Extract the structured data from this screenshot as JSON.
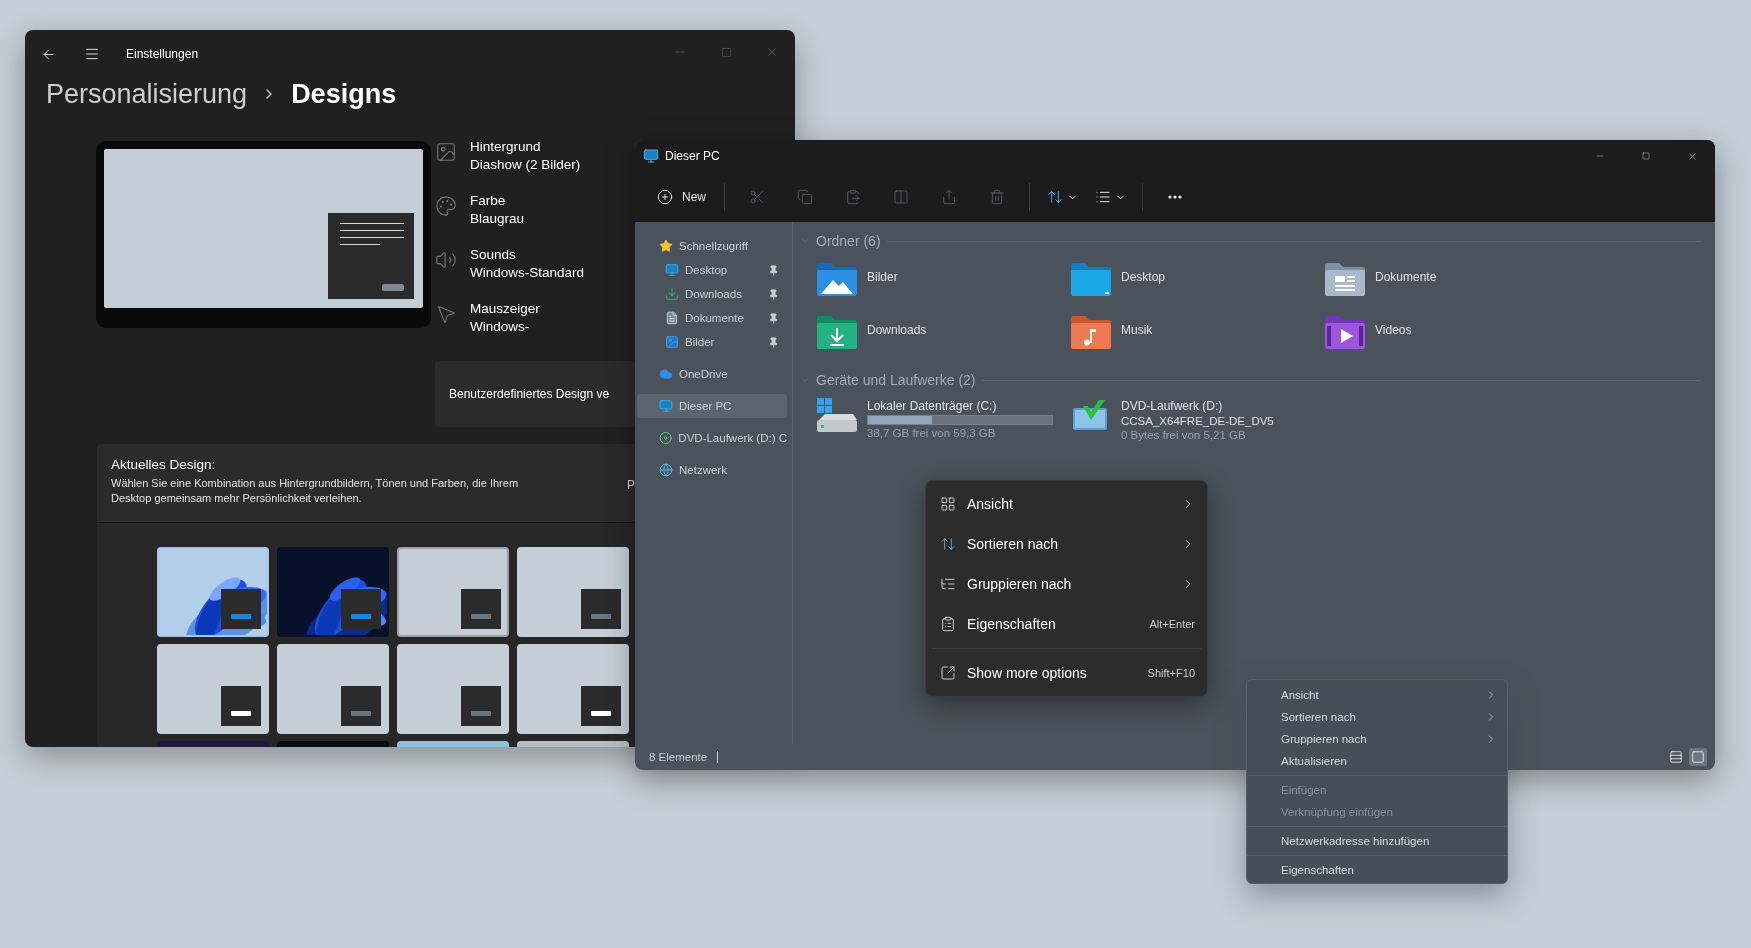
{
  "settings": {
    "title": "Einstellungen",
    "breadcrumb": [
      {
        "label": "Personalisierung",
        "selected": false
      },
      {
        "label": "Designs",
        "selected": true
      }
    ],
    "summary": [
      {
        "kind": "background",
        "label": "Hintergrund",
        "value": "Diashow (2 Bilder)"
      },
      {
        "kind": "color",
        "label": "Farbe",
        "value": "Blaugrau"
      },
      {
        "kind": "sounds",
        "label": "Sounds",
        "value": "Windows-Standard"
      },
      {
        "kind": "pointer",
        "label": "Mauszeiger",
        "value": "Windows-"
      }
    ],
    "custom_design": "Benutzerdefiniertes Design ve",
    "current_design": {
      "title": "Aktuelles Design:",
      "description": "Wählen Sie eine Kombination aus Hintergrundbildern, Tönen und Farben, die Ihrem Desktop gemeinsam mehr Persönlichkeit verleihen.",
      "action": "P"
    },
    "themes": [
      {
        "kind": "bloom-light",
        "selected": false,
        "color": "#1a86d9"
      },
      {
        "kind": "bloom-dark",
        "selected": false,
        "color": "#1a86d9"
      },
      {
        "kind": "plain",
        "selected": true,
        "color": "#6b7580"
      },
      {
        "kind": "plain",
        "selected": false,
        "color": "#6b7580"
      },
      {
        "kind": "plain",
        "selected": false,
        "color": "#ffffff"
      },
      {
        "kind": "plain",
        "selected": false,
        "color": "#6b7580"
      },
      {
        "kind": "plain",
        "selected": false,
        "color": "#6b7580"
      },
      {
        "kind": "plain",
        "selected": false,
        "color": "#ffffff"
      },
      {
        "kind": "night",
        "selected": false
      },
      {
        "kind": "black",
        "selected": false
      },
      {
        "kind": "sky",
        "selected": false
      },
      {
        "kind": "fog",
        "selected": false
      }
    ]
  },
  "explorer": {
    "title": "Dieser PC",
    "toolbar": [
      {
        "kind": "new",
        "label": "New",
        "disabled": false
      },
      {
        "kind": "cut",
        "disabled": true
      },
      {
        "kind": "copy",
        "disabled": true
      },
      {
        "kind": "paste",
        "disabled": true
      },
      {
        "kind": "rename",
        "disabled": true
      },
      {
        "kind": "share",
        "disabled": true
      },
      {
        "kind": "delete",
        "disabled": true
      },
      {
        "kind": "sort",
        "disabled": false
      },
      {
        "kind": "view",
        "disabled": false
      },
      {
        "kind": "more",
        "disabled": false
      }
    ],
    "sidebar": [
      {
        "kind": "star",
        "label": "Schnellzugriff",
        "selected": false,
        "children": [
          {
            "kind": "desktop",
            "label": "Desktop",
            "pinned": true,
            "selected": false
          },
          {
            "kind": "downloads",
            "label": "Downloads",
            "pinned": true,
            "selected": false
          },
          {
            "kind": "documents",
            "label": "Dokumente",
            "pinned": true,
            "selected": false
          },
          {
            "kind": "pictures",
            "label": "Bilder",
            "pinned": true,
            "selected": false
          }
        ]
      },
      {
        "kind": "cloud",
        "label": "OneDrive",
        "selected": false
      },
      {
        "kind": "pc",
        "label": "Dieser PC",
        "selected": true
      },
      {
        "kind": "dvd",
        "label": "DVD-Laufwerk (D:) C",
        "selected": false
      },
      {
        "kind": "network",
        "label": "Netzwerk",
        "selected": false
      }
    ],
    "groups": [
      {
        "kind": "folders",
        "title": "Ordner (6)",
        "expanded": true,
        "items": [
          {
            "kind": "pictures",
            "label": "Bilder"
          },
          {
            "kind": "desktop",
            "label": "Desktop"
          },
          {
            "kind": "documents",
            "label": "Dokumente"
          },
          {
            "kind": "downloads",
            "label": "Downloads"
          },
          {
            "kind": "music",
            "label": "Musik"
          },
          {
            "kind": "videos",
            "label": "Videos"
          }
        ]
      },
      {
        "kind": "drives",
        "title": "Geräte und Laufwerke (2)",
        "expanded": true,
        "items": [
          {
            "kind": "system",
            "label": "Lokaler Datenträger (C:)",
            "level": 0.35,
            "free": "38,7 GB frei von 59,3 GB"
          },
          {
            "kind": "dvd",
            "label": "DVD-Laufwerk (D:)",
            "volume": "CCSA_X64FRE_DE-DE_DV5",
            "free": "0 Bytes frei von 5,21 GB"
          }
        ]
      }
    ],
    "status": "8 Elemente",
    "views": [
      {
        "kind": "details",
        "selected": false
      },
      {
        "kind": "tiles",
        "selected": true
      }
    ]
  },
  "context_menu": [
    {
      "kind": "view",
      "label": "Ansicht",
      "submenu": true
    },
    {
      "kind": "sort",
      "label": "Sortieren nach",
      "submenu": true
    },
    {
      "kind": "group",
      "label": "Gruppieren nach",
      "submenu": true
    },
    {
      "kind": "properties",
      "label": "Eigenschaften",
      "submenu": false,
      "shortcut": "Alt+Enter"
    },
    {
      "kind": "more",
      "label": "Show more options",
      "submenu": false,
      "shortcut": "Shift+F10",
      "separated": true
    }
  ],
  "classic_menu": [
    {
      "items": [
        {
          "label": "Ansicht",
          "submenu": true,
          "disabled": false
        },
        {
          "label": "Sortieren nach",
          "submenu": true,
          "disabled": false
        },
        {
          "label": "Gruppieren nach",
          "submenu": true,
          "disabled": false
        },
        {
          "label": "Aktualisieren",
          "submenu": false,
          "disabled": false
        }
      ]
    },
    {
      "items": [
        {
          "label": "Einfügen",
          "submenu": false,
          "disabled": true
        },
        {
          "label": "Verknüpfung einfügen",
          "submenu": false,
          "disabled": true
        }
      ]
    },
    {
      "items": [
        {
          "label": "Netzwerkadresse hinzufügen",
          "submenu": false,
          "disabled": false
        }
      ]
    },
    {
      "items": [
        {
          "label": "Eigenschaften",
          "submenu": false,
          "disabled": false
        }
      ]
    }
  ]
}
